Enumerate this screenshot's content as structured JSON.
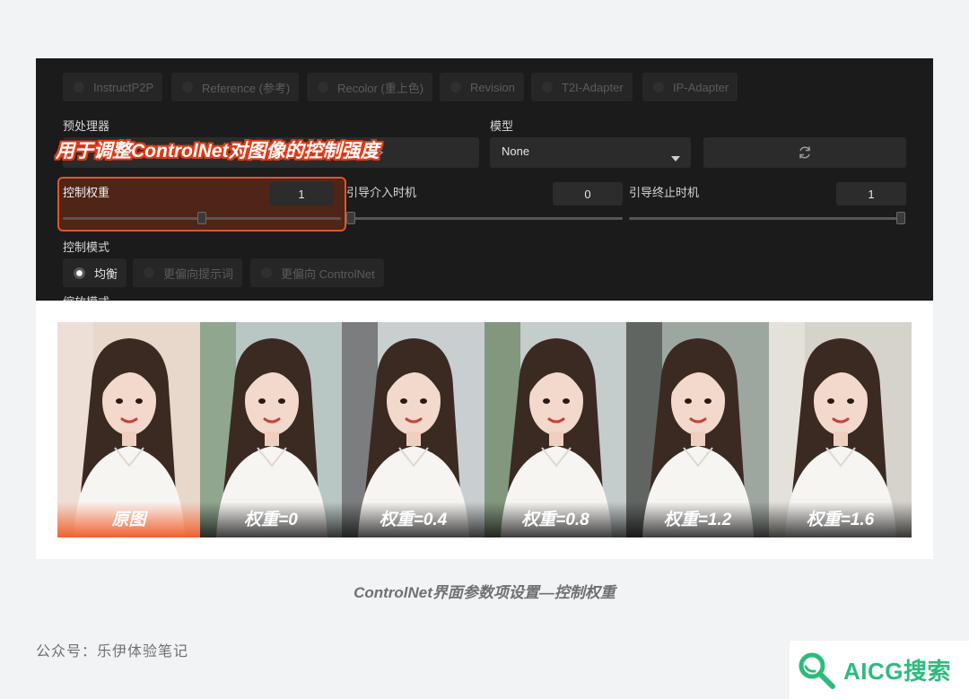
{
  "radio_row": [
    "InstructP2P",
    "Reference (参考)",
    "Recolor (重上色)",
    "Revision",
    "T2I-Adapter",
    "IP-Adapter"
  ],
  "preprocessor_label": "预处理器",
  "model_label": "模型",
  "model_value": "None",
  "annotation": "用于调整ControlNet对图像的控制强度",
  "sliders": {
    "weight": {
      "label": "控制权重",
      "value": "1",
      "level": 0.5
    },
    "start": {
      "label": "引导介入时机",
      "value": "0",
      "level": 0.0
    },
    "end": {
      "label": "引导终止时机",
      "value": "1",
      "level": 1.0
    }
  },
  "control_mode_label": "控制模式",
  "control_modes": [
    "均衡",
    "更偏向提示词",
    "更偏向 ControlNet"
  ],
  "resize_label_partial": "缩放模式",
  "photos": [
    "原图",
    "权重=0",
    "权重=0.4",
    "权重=0.8",
    "权重=1.2",
    "权重=1.6"
  ],
  "caption": "ControlNet界面参数项设置—控制权重",
  "footer": "公众号：乐伊体验笔记",
  "logo_text": "AICG搜索",
  "colors": {
    "accent": "#e2542a",
    "logo": "#2dbb7c",
    "panel_bg": "#1b1b1b"
  }
}
